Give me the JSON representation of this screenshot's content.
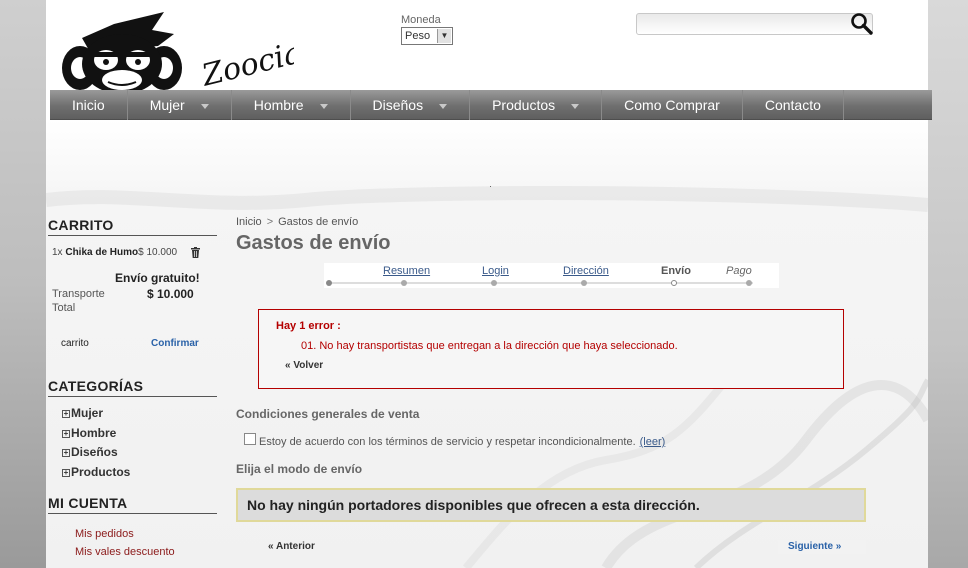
{
  "header": {
    "brand": "Zoocia",
    "currency_label": "Moneda",
    "currency_value": "Peso",
    "search_placeholder": ""
  },
  "nav": {
    "items": [
      {
        "label": "Inicio",
        "dropdown": false
      },
      {
        "label": "Mujer",
        "dropdown": true
      },
      {
        "label": "Hombre",
        "dropdown": true
      },
      {
        "label": "Diseños",
        "dropdown": true
      },
      {
        "label": "Productos",
        "dropdown": true
      },
      {
        "label": "Como Comprar",
        "dropdown": false
      },
      {
        "label": "Contacto",
        "dropdown": false
      }
    ]
  },
  "cart": {
    "title": "CARRITO",
    "item_qty": "1x",
    "item_name": "Chika de Humo",
    "item_price": "$ 10.000",
    "free_shipping": "Envío gratuito!",
    "shipping_label": "Transporte",
    "shipping_value": "$ 10.000",
    "total_label": "Total",
    "cart_link": "carrito",
    "confirm_link": "Confirmar"
  },
  "categories": {
    "title": "CATEGORÍAS",
    "items": [
      "Mujer",
      "Hombre",
      "Diseños",
      "Productos"
    ]
  },
  "account": {
    "title": "MI CUENTA",
    "items": [
      "Mis pedidos",
      "Mis vales descuento"
    ]
  },
  "main": {
    "breadcrumb": {
      "home": "Inicio",
      "sep": ">",
      "current": "Gastos de envío"
    },
    "title": "Gastos de envío",
    "steps": [
      {
        "label": "Resumen",
        "state": "done"
      },
      {
        "label": "Login",
        "state": "done"
      },
      {
        "label": "Dirección",
        "state": "done"
      },
      {
        "label": "Envío",
        "state": "current"
      },
      {
        "label": "Pago",
        "state": "next"
      }
    ],
    "error": {
      "title": "Hay 1 error :",
      "message": "01. No hay transportistas que entregan a la dirección que haya seleccionado.",
      "back": "« Volver"
    },
    "terms": {
      "heading": "Condiciones generales de venta",
      "label": "Estoy de acuerdo con los términos de servicio y respetar incondicionalmente.",
      "link": "(leer)"
    },
    "shipping": {
      "heading": "Elija el modo de envío",
      "warning": "No hay ningún portadores disponibles que ofrecen a esta dirección."
    },
    "prev_button": "« Anterior",
    "next_button": "Siguiente »"
  },
  "colors": {
    "nav_bg": "#6f6f6f",
    "error_red": "#b40000",
    "link_blue": "#2a62a8",
    "warning_border": "#e0d99a"
  }
}
